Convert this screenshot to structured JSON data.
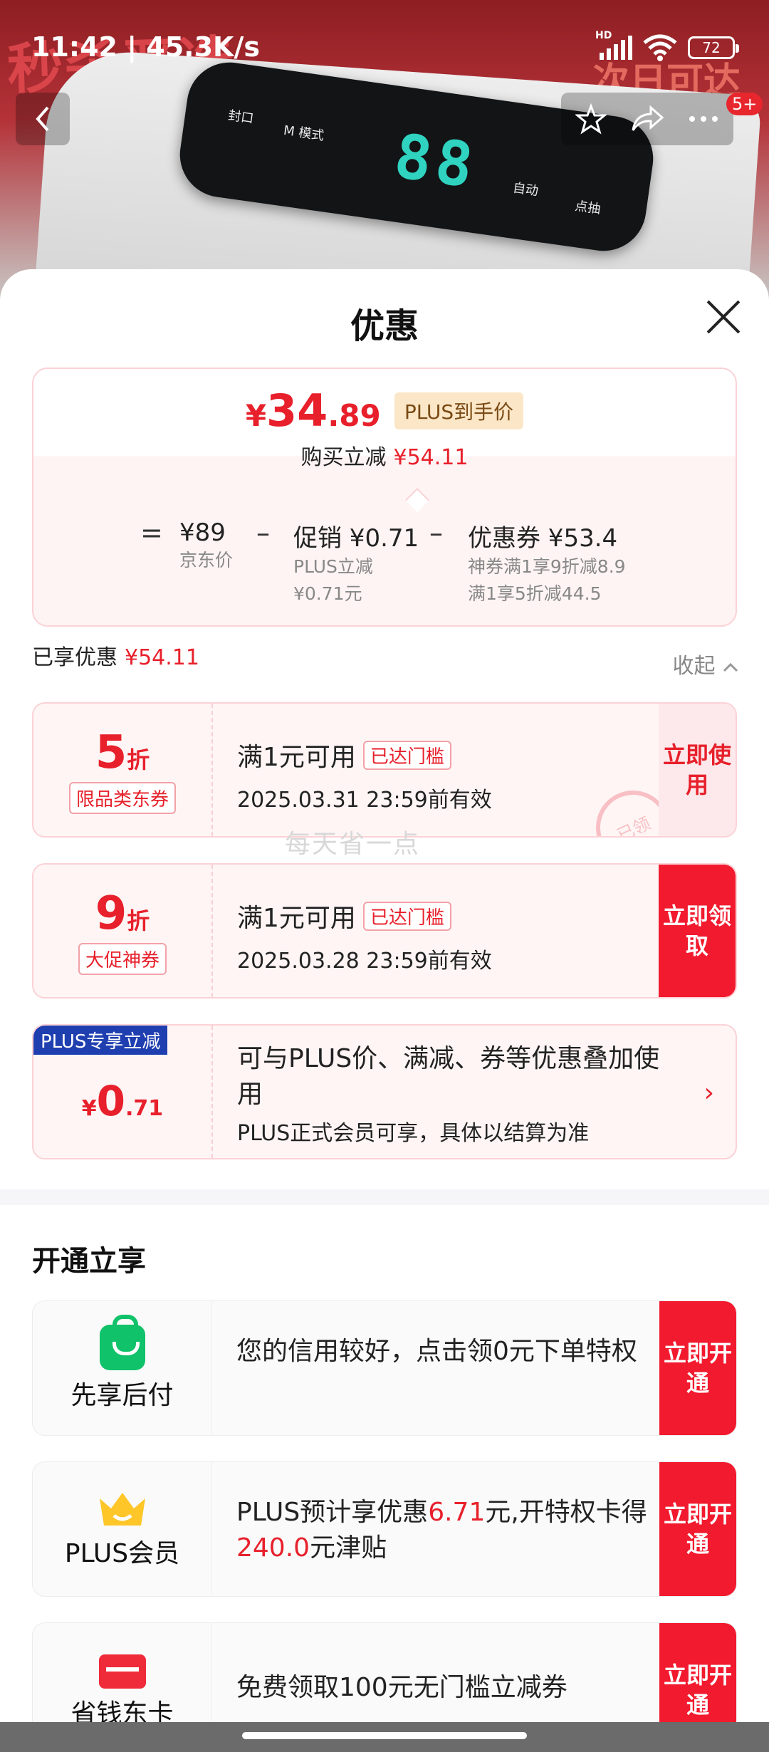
{
  "status_bar": {
    "time": "11:42 | 45.3K/s",
    "network": "HD",
    "battery": "72"
  },
  "nav": {
    "more_badge": "5+"
  },
  "hero": {
    "banner_left": "秒杀严选",
    "banner_right": "次日可达",
    "panel_digits": "88",
    "panel_labels": [
      "封口",
      "M 模式",
      "自动",
      "点抽"
    ]
  },
  "sheet": {
    "title": "优惠"
  },
  "price_card": {
    "symbol": "¥",
    "price_int": "34",
    "price_dec": ".89",
    "plus_tag": "PLUS到手价",
    "instant_label": "购买立减",
    "instant_value": "¥54.11",
    "equals": "=",
    "jd_price": "¥89",
    "jd_label": "京东价",
    "minus1": "–",
    "promo": "促销 ¥0.71",
    "promo_sub1": "PLUS立减",
    "promo_sub2": "¥0.71元",
    "minus2": "–",
    "coupon": "优惠券 ¥53.4",
    "coupon_sub1": "神券满1享9折减8.9",
    "coupon_sub2": "满1享5折减44.5"
  },
  "enjoyed": {
    "label": "已享优惠",
    "value": "¥54.11",
    "collapse": "收起"
  },
  "coupons": [
    {
      "discount": "5",
      "unit": "折",
      "tag": "限品类东券",
      "condition": "满1元可用",
      "met": "已达门槛",
      "expiry": "2025.03.31 23:59前有效",
      "button": "立即使用",
      "stamp": "已领"
    },
    {
      "discount": "9",
      "unit": "折",
      "tag": "大促神券",
      "condition": "满1元可用",
      "met": "已达门槛",
      "expiry": "2025.03.28 23:59前有效",
      "button": "立即领取"
    }
  ],
  "watermark": "每天省一点",
  "plus_card": {
    "tag": "PLUS专享立减",
    "symbol": "¥",
    "int": "0",
    "dec": ".71",
    "line1": "可与PLUS价、满减、券等优惠叠加使用",
    "line2": "PLUS正式会员可享，具体以结算为准",
    "chevron": "›"
  },
  "open_section": {
    "title": "开通立享"
  },
  "open_cards": [
    {
      "label": "先享后付",
      "text": "您的信用较好，点击领0元下单特权",
      "button": "立即开通",
      "icon": "shopping-bag-icon"
    },
    {
      "label": "PLUS会员",
      "text_a": "PLUS预计享优惠",
      "red_a": "6.71",
      "text_b": "元,开特权卡得",
      "red_b": "240.0",
      "text_c": "元津贴",
      "button": "立即开通",
      "icon": "crown-icon"
    },
    {
      "label": "省钱东卡",
      "text": "免费领取100元无门槛立减券",
      "button": "立即开通",
      "icon": "card-icon"
    }
  ],
  "colors": {
    "accent_red": "#e7202b",
    "button_red": "#f21a2e",
    "plus_blue": "#1f3fb0",
    "green": "#10c26a"
  }
}
